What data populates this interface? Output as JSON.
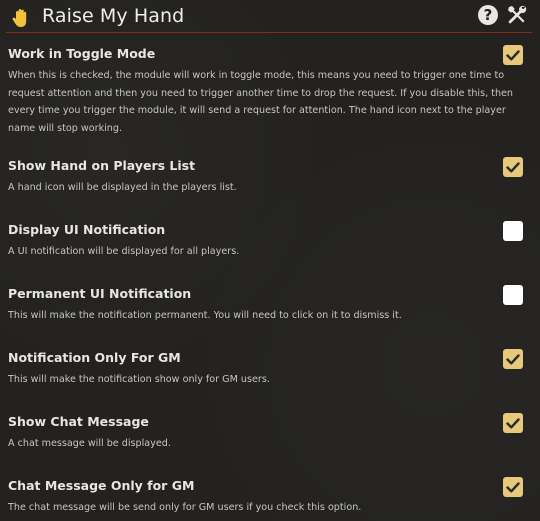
{
  "header": {
    "title": "Raise My Hand",
    "icons": [
      "hand-icon",
      "help-icon",
      "tools-icon"
    ],
    "help_glyph": "?"
  },
  "colors": {
    "accent_rule": "#8a2a18",
    "checkbox_on": "#e8c97a",
    "hand": "#f2c23a",
    "background": "#232220"
  },
  "settings": [
    {
      "label": "Work in Toggle Mode",
      "hint": "When this is checked, the module will work in toggle mode, this means you need to trigger one time to request attention and then you need to trigger another time to drop the request. If you disable this, then every time you trigger the module, it will send a request for attention. The hand icon next to the player name will stop working.",
      "checked": true
    },
    {
      "label": "Show Hand on Players List",
      "hint": "A hand icon will be displayed in the players list.",
      "checked": true
    },
    {
      "label": "Display UI Notification",
      "hint": "A UI notification will be displayed for all players.",
      "checked": false
    },
    {
      "label": "Permanent UI Notification",
      "hint": "This will make the notification permanent. You will need to click on it to dismiss it.",
      "checked": false
    },
    {
      "label": "Notification Only For GM",
      "hint": "This will make the notification show only for GM users.",
      "checked": true
    },
    {
      "label": "Show Chat Message",
      "hint": "A chat message will be displayed.",
      "checked": true
    },
    {
      "label": "Chat Message Only for GM",
      "hint": "The chat message will be send only for GM users if you check this option.",
      "checked": true
    }
  ]
}
